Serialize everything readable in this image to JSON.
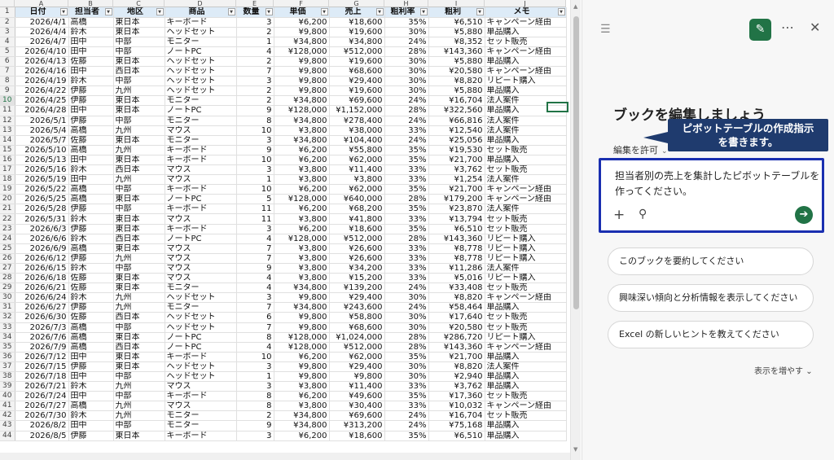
{
  "sheet": {
    "columns": [
      "A",
      "B",
      "C",
      "D",
      "E",
      "F",
      "G",
      "H",
      "I",
      "J"
    ],
    "headers": [
      "日付",
      "担当者",
      "地区",
      "商品",
      "数量",
      "単価",
      "売上",
      "粗利率",
      "粗利",
      "メモ"
    ],
    "row_numbers": [
      "1",
      "2",
      "3",
      "4",
      "5",
      "6",
      "7",
      "8",
      "9",
      "10",
      "11",
      "12",
      "13",
      "14",
      "15",
      "16",
      "17",
      "18",
      "19",
      "20",
      "21",
      "22",
      "23",
      "24",
      "25",
      "26",
      "27",
      "28",
      "29",
      "30",
      "31",
      "32",
      "33",
      "34",
      "35",
      "36",
      "37",
      "38",
      "39",
      "40",
      "41",
      "42",
      "43",
      "44"
    ],
    "rows": [
      [
        "2026/4/1",
        "高橋",
        "東日本",
        "キーボード",
        "3",
        "¥6,200",
        "¥18,600",
        "35%",
        "¥6,510",
        "キャンペーン経由"
      ],
      [
        "2026/4/4",
        "鈴木",
        "東日本",
        "ヘッドセット",
        "2",
        "¥9,800",
        "¥19,600",
        "30%",
        "¥5,880",
        "単品購入"
      ],
      [
        "2026/4/7",
        "田中",
        "中部",
        "モニター",
        "1",
        "¥34,800",
        "¥34,800",
        "24%",
        "¥8,352",
        "セット販売"
      ],
      [
        "2026/4/10",
        "田中",
        "中部",
        "ノートPC",
        "4",
        "¥128,000",
        "¥512,000",
        "28%",
        "¥143,360",
        "キャンペーン経由"
      ],
      [
        "2026/4/13",
        "佐藤",
        "東日本",
        "ヘッドセット",
        "2",
        "¥9,800",
        "¥19,600",
        "30%",
        "¥5,880",
        "単品購入"
      ],
      [
        "2026/4/16",
        "田中",
        "西日本",
        "ヘッドセット",
        "7",
        "¥9,800",
        "¥68,600",
        "30%",
        "¥20,580",
        "キャンペーン経由"
      ],
      [
        "2026/4/19",
        "鈴木",
        "中部",
        "ヘッドセット",
        "3",
        "¥9,800",
        "¥29,400",
        "30%",
        "¥8,820",
        "リピート購入"
      ],
      [
        "2026/4/22",
        "伊藤",
        "九州",
        "ヘッドセット",
        "2",
        "¥9,800",
        "¥19,600",
        "30%",
        "¥5,880",
        "単品購入"
      ],
      [
        "2026/4/25",
        "伊藤",
        "東日本",
        "モニター",
        "2",
        "¥34,800",
        "¥69,600",
        "24%",
        "¥16,704",
        "法人案件"
      ],
      [
        "2026/4/28",
        "田中",
        "東日本",
        "ノートPC",
        "9",
        "¥128,000",
        "¥1,152,000",
        "28%",
        "¥322,560",
        "単品購入"
      ],
      [
        "2026/5/1",
        "伊藤",
        "中部",
        "モニター",
        "8",
        "¥34,800",
        "¥278,400",
        "24%",
        "¥66,816",
        "法人案件"
      ],
      [
        "2026/5/4",
        "高橋",
        "九州",
        "マウス",
        "10",
        "¥3,800",
        "¥38,000",
        "33%",
        "¥12,540",
        "法人案件"
      ],
      [
        "2026/5/7",
        "佐藤",
        "東日本",
        "モニター",
        "3",
        "¥34,800",
        "¥104,400",
        "24%",
        "¥25,056",
        "単品購入"
      ],
      [
        "2026/5/10",
        "高橋",
        "九州",
        "キーボード",
        "9",
        "¥6,200",
        "¥55,800",
        "35%",
        "¥19,530",
        "セット販売"
      ],
      [
        "2026/5/13",
        "田中",
        "東日本",
        "キーボード",
        "10",
        "¥6,200",
        "¥62,000",
        "35%",
        "¥21,700",
        "単品購入"
      ],
      [
        "2026/5/16",
        "鈴木",
        "西日本",
        "マウス",
        "3",
        "¥3,800",
        "¥11,400",
        "33%",
        "¥3,762",
        "セット販売"
      ],
      [
        "2026/5/19",
        "田中",
        "九州",
        "マウス",
        "1",
        "¥3,800",
        "¥3,800",
        "33%",
        "¥1,254",
        "法人案件"
      ],
      [
        "2026/5/22",
        "高橋",
        "中部",
        "キーボード",
        "10",
        "¥6,200",
        "¥62,000",
        "35%",
        "¥21,700",
        "キャンペーン経由"
      ],
      [
        "2026/5/25",
        "高橋",
        "東日本",
        "ノートPC",
        "5",
        "¥128,000",
        "¥640,000",
        "28%",
        "¥179,200",
        "キャンペーン経由"
      ],
      [
        "2026/5/28",
        "伊藤",
        "中部",
        "キーボード",
        "11",
        "¥6,200",
        "¥68,200",
        "35%",
        "¥23,870",
        "法人案件"
      ],
      [
        "2026/5/31",
        "鈴木",
        "東日本",
        "マウス",
        "11",
        "¥3,800",
        "¥41,800",
        "33%",
        "¥13,794",
        "セット販売"
      ],
      [
        "2026/6/3",
        "伊藤",
        "東日本",
        "キーボード",
        "3",
        "¥6,200",
        "¥18,600",
        "35%",
        "¥6,510",
        "セット販売"
      ],
      [
        "2026/6/6",
        "鈴木",
        "西日本",
        "ノートPC",
        "4",
        "¥128,000",
        "¥512,000",
        "28%",
        "¥143,360",
        "リピート購入"
      ],
      [
        "2026/6/9",
        "高橋",
        "東日本",
        "マウス",
        "7",
        "¥3,800",
        "¥26,600",
        "33%",
        "¥8,778",
        "リピート購入"
      ],
      [
        "2026/6/12",
        "伊藤",
        "九州",
        "マウス",
        "7",
        "¥3,800",
        "¥26,600",
        "33%",
        "¥8,778",
        "リピート購入"
      ],
      [
        "2026/6/15",
        "鈴木",
        "中部",
        "マウス",
        "9",
        "¥3,800",
        "¥34,200",
        "33%",
        "¥11,286",
        "法人案件"
      ],
      [
        "2026/6/18",
        "佐藤",
        "東日本",
        "マウス",
        "4",
        "¥3,800",
        "¥15,200",
        "33%",
        "¥5,016",
        "リピート購入"
      ],
      [
        "2026/6/21",
        "佐藤",
        "東日本",
        "モニター",
        "4",
        "¥34,800",
        "¥139,200",
        "24%",
        "¥33,408",
        "セット販売"
      ],
      [
        "2026/6/24",
        "鈴木",
        "九州",
        "ヘッドセット",
        "3",
        "¥9,800",
        "¥29,400",
        "30%",
        "¥8,820",
        "キャンペーン経由"
      ],
      [
        "2026/6/27",
        "伊藤",
        "九州",
        "モニター",
        "7",
        "¥34,800",
        "¥243,600",
        "24%",
        "¥58,464",
        "単品購入"
      ],
      [
        "2026/6/30",
        "佐藤",
        "西日本",
        "ヘッドセット",
        "6",
        "¥9,800",
        "¥58,800",
        "30%",
        "¥17,640",
        "セット販売"
      ],
      [
        "2026/7/3",
        "高橋",
        "中部",
        "ヘッドセット",
        "7",
        "¥9,800",
        "¥68,600",
        "30%",
        "¥20,580",
        "セット販売"
      ],
      [
        "2026/7/6",
        "高橋",
        "東日本",
        "ノートPC",
        "8",
        "¥128,000",
        "¥1,024,000",
        "28%",
        "¥286,720",
        "リピート購入"
      ],
      [
        "2026/7/9",
        "高橋",
        "西日本",
        "ノートPC",
        "4",
        "¥128,000",
        "¥512,000",
        "28%",
        "¥143,360",
        "キャンペーン経由"
      ],
      [
        "2026/7/12",
        "田中",
        "東日本",
        "キーボード",
        "10",
        "¥6,200",
        "¥62,000",
        "35%",
        "¥21,700",
        "単品購入"
      ],
      [
        "2026/7/15",
        "伊藤",
        "東日本",
        "ヘッドセット",
        "3",
        "¥9,800",
        "¥29,400",
        "30%",
        "¥8,820",
        "法人案件"
      ],
      [
        "2026/7/18",
        "田中",
        "中部",
        "ヘッドセット",
        "1",
        "¥9,800",
        "¥9,800",
        "30%",
        "¥2,940",
        "単品購入"
      ],
      [
        "2026/7/21",
        "鈴木",
        "九州",
        "マウス",
        "3",
        "¥3,800",
        "¥11,400",
        "33%",
        "¥3,762",
        "単品購入"
      ],
      [
        "2026/7/24",
        "田中",
        "中部",
        "キーボード",
        "8",
        "¥6,200",
        "¥49,600",
        "35%",
        "¥17,360",
        "セット販売"
      ],
      [
        "2026/7/27",
        "高橋",
        "九州",
        "マウス",
        "8",
        "¥3,800",
        "¥30,400",
        "33%",
        "¥10,032",
        "キャンペーン経由"
      ],
      [
        "2026/7/30",
        "鈴木",
        "九州",
        "モニター",
        "2",
        "¥34,800",
        "¥69,600",
        "24%",
        "¥16,704",
        "セット販売"
      ],
      [
        "2026/8/2",
        "田中",
        "中部",
        "モニター",
        "9",
        "¥34,800",
        "¥313,200",
        "24%",
        "¥75,168",
        "単品購入"
      ],
      [
        "2026/8/5",
        "伊藤",
        "東日本",
        "キーボード",
        "3",
        "¥6,200",
        "¥18,600",
        "35%",
        "¥6,510",
        "単品購入"
      ]
    ]
  },
  "copilot": {
    "title": "ブックを編集しましょう",
    "permission_label": "編集を許可",
    "input_text": "担当者別の売上を集計したピボットテーブルを作ってください。",
    "suggestions": [
      "このブックを要約してください",
      "興味深い傾向と分析情報を表示してください",
      "Excel の新しいヒントを教えてください"
    ],
    "show_more": "表示を増やす",
    "callout_line1": "ピボットテーブルの作成指示",
    "callout_line2": "を書きます。"
  },
  "icons": {
    "menu": "hamburger-icon",
    "new_chat": "new-chat-icon",
    "more": "more-icon",
    "close": "close-icon",
    "add": "plus-icon",
    "attach": "attach-icon",
    "send": "send-icon"
  },
  "colors": {
    "accent": "#217346",
    "header_fill": "#ddebf7",
    "callout": "#1f3b6e",
    "input_border": "#1a2fb0"
  }
}
